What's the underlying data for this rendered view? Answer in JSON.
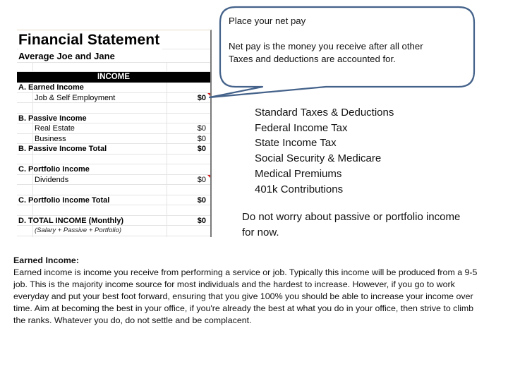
{
  "sheet": {
    "title": "Financial Statement",
    "subtitle": "Average Joe and Jane",
    "section_header": "INCOME",
    "rows": [
      {
        "label": "A. Earned Income",
        "value": "",
        "bold": true
      },
      {
        "label": "Job & Self Employment",
        "value": "$0",
        "bold_value": true,
        "indent": true,
        "comment": true
      },
      {
        "label": "",
        "value": ""
      },
      {
        "label": "B. Passive Income",
        "value": "",
        "bold": true
      },
      {
        "label": "Real Estate",
        "value": "$0",
        "indent": true
      },
      {
        "label": "Business",
        "value": "$0",
        "indent": true
      },
      {
        "label": "B. Passive Income Total",
        "value": "$0",
        "bold": true
      },
      {
        "label": "",
        "value": ""
      },
      {
        "label": "C. Portfolio Income",
        "value": "",
        "bold": true
      },
      {
        "label": "Dividends",
        "value": "$0",
        "indent": true,
        "comment": true
      },
      {
        "label": "",
        "value": ""
      },
      {
        "label": "C. Portfolio Income Total",
        "value": "$0",
        "bold": true
      },
      {
        "label": "",
        "value": ""
      },
      {
        "label": "D. TOTAL INCOME (Monthly)",
        "value": "$0",
        "bold": true
      },
      {
        "label": "(Salary + Passive + Portfolio)",
        "value": "",
        "italic": true,
        "indent": true
      }
    ]
  },
  "callout": {
    "line1": "Place your net pay",
    "line2": "Net pay is the money you receive after all other",
    "line3": "Taxes and deductions are accounted for.",
    "border_color": "#44628a"
  },
  "deductions": [
    "Standard Taxes & Deductions",
    "Federal Income Tax",
    "State Income Tax",
    "Social Security & Medicare",
    "Medical Premiums",
    "401k Contributions"
  ],
  "note": "Do not worry about passive or portfolio income for now.",
  "earned_income": {
    "heading": "Earned Income:",
    "body": "Earned income is income you receive from performing a service or job. Typically this income will be produced from a 9-5 job. This is the majority income source for most individuals and the hardest to increase. However, if you go to work everyday and put your best foot forward, ensuring that you give 100% you should be able to increase your income over time. Aim at becoming the best in your office, if you're already the best at what you do in your office, then strive to climb the ranks. Whatever you do, do not settle and be complacent."
  }
}
